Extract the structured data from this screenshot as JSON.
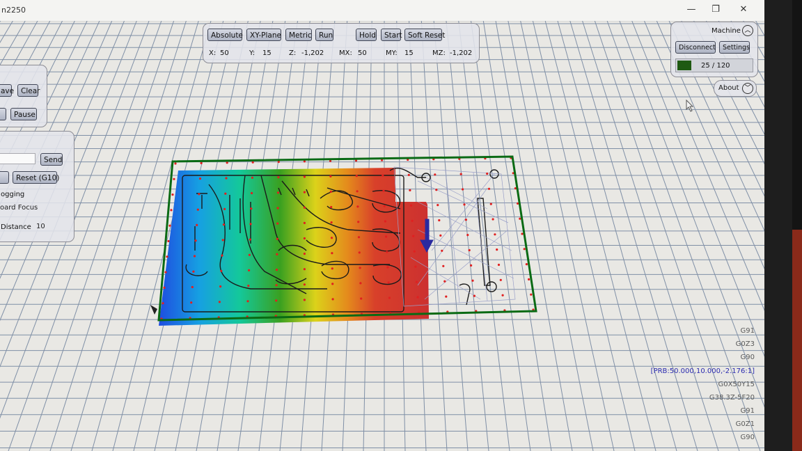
{
  "window": {
    "title": "n2250",
    "minimize_glyph": "—",
    "restore_glyph": "❐",
    "close_glyph": "✕"
  },
  "toolbar": {
    "absolute_label": "Absolute",
    "plane_label": "XY-Plane",
    "metric_label": "Metric",
    "run_label": "Run",
    "hold_label": "Hold",
    "start_label": "Start",
    "soft_reset_label": "Soft Reset",
    "x_label": "X:",
    "x_value": "50",
    "y_label": "Y:",
    "y_value": "15",
    "z_label": "Z:",
    "z_value": "-1,202",
    "mx_label": "MX:",
    "mx_value": "50",
    "my_label": "MY:",
    "my_value": "15",
    "mz_label": "MZ:",
    "mz_value": "-1,202"
  },
  "machine_panel": {
    "title": "Machine",
    "disconnect_label": "Disconnect",
    "settings_label": "Settings",
    "buffer_text": "25 / 120",
    "status_color": "#1f5a12"
  },
  "about_button": {
    "label": "About"
  },
  "file_panel": {
    "save_label": "ave",
    "clear_label": "Clear",
    "pause_label": "Pause"
  },
  "manual_panel": {
    "send_label": "Send",
    "reset_label": "Reset (G10)",
    "jogging_label": "ogging",
    "keyboard_focus_label": "oard Focus",
    "distance_label": "Distance",
    "distance_value": "10"
  },
  "console": {
    "lines": [
      "G91",
      "G0Z3",
      "G90",
      "[PRB:50.000,10.000,-2.176:1]",
      "G0X50Y15",
      "G38.3Z-5F20",
      "G91",
      "G0Z1",
      "G90"
    ]
  },
  "colors": {
    "accent_green": "#0a6a14",
    "probe_arrow": "#2a2aa0",
    "probe_point": "#e02020",
    "grid_line": "#7f8fa6"
  }
}
